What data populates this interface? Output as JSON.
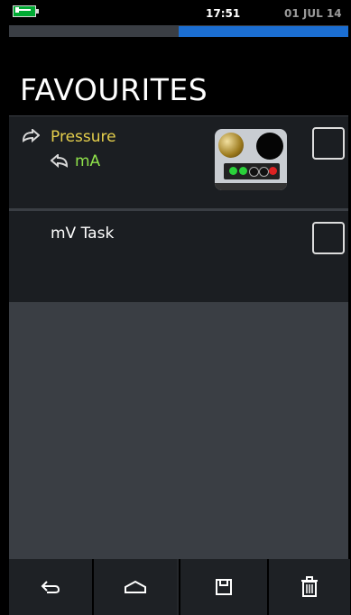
{
  "status": {
    "time": "17:51",
    "date": "01 JUL 14"
  },
  "header": {
    "title": "FAVOURITES"
  },
  "favourites": [
    {
      "labels": [
        "Pressure",
        "mA"
      ],
      "has_image": true,
      "checked": false
    },
    {
      "labels": [
        "mV Task"
      ],
      "has_image": false,
      "checked": false
    }
  ],
  "toolbar": {
    "icons": [
      "back-arrow-icon",
      "home-icon",
      "save-icon",
      "trash-icon"
    ]
  },
  "colors": {
    "pressure": "#e5cf4c",
    "ma": "#8fe24b",
    "progress": "#1b6ed2"
  }
}
